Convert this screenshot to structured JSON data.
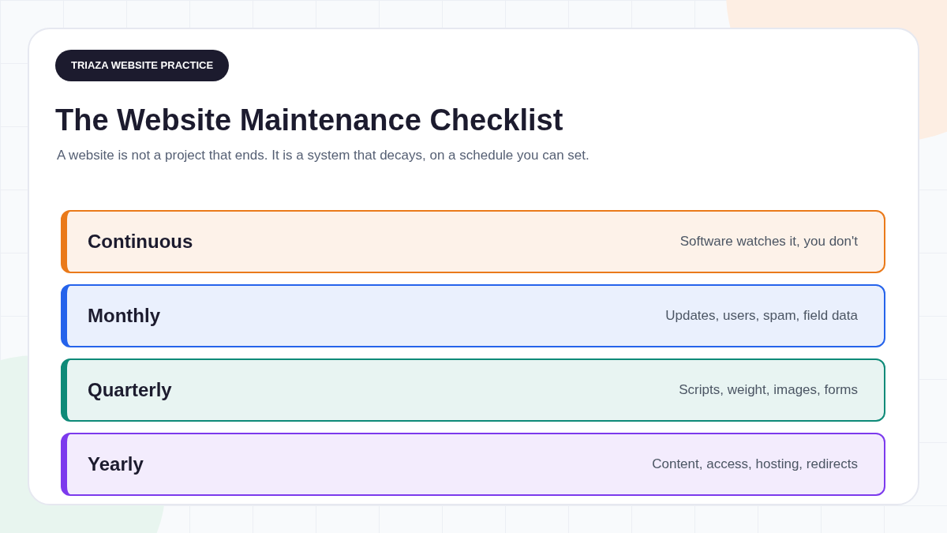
{
  "badge": "TRIAZA WEBSITE PRACTICE",
  "title": "The Website Maintenance Checklist",
  "subtitle": "A website is not a project that ends. It is a system that decays, on a schedule you can set.",
  "rows": [
    {
      "label": "Continuous",
      "note": "Software watches it, you don't",
      "color": "#ea7a1a"
    },
    {
      "label": "Monthly",
      "note": "Updates, users, spam, field data",
      "color": "#2563eb"
    },
    {
      "label": "Quarterly",
      "note": "Scripts, weight, images, forms",
      "color": "#0e8a78"
    },
    {
      "label": "Yearly",
      "note": "Content, access, hosting, redirects",
      "color": "#7c3aed"
    }
  ]
}
